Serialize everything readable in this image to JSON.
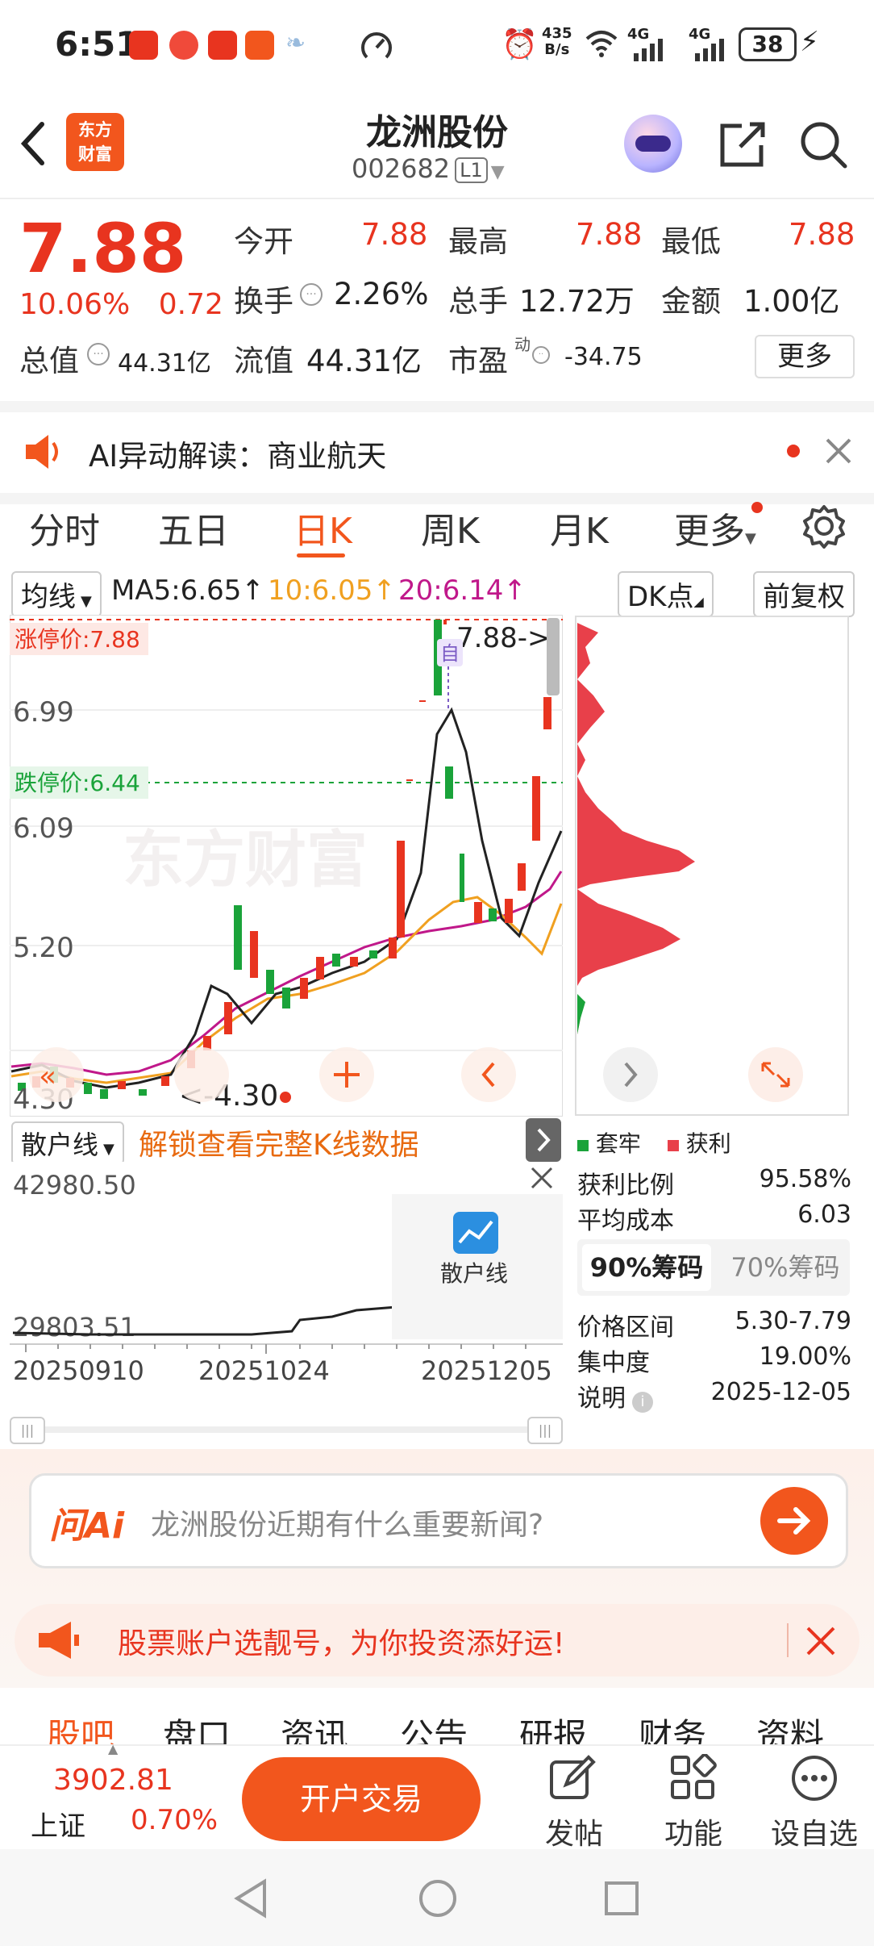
{
  "status_bar": {
    "time": "6:51",
    "net_speed_top": "435",
    "net_speed_unit": "B/s",
    "signal1": "4G",
    "signal2": "4G",
    "battery": "38"
  },
  "header": {
    "logo_line1": "东方",
    "logo_line2": "财富",
    "stock_name": "龙洲股份",
    "stock_code": "002682",
    "level": "L1"
  },
  "quote": {
    "price": "7.88",
    "change_pct": "10.06%",
    "change_abs": "0.72",
    "open_label": "今开",
    "open_value": "7.88",
    "high_label": "最高",
    "high_value": "7.88",
    "low_label": "最低",
    "low_value": "7.88",
    "turnover_label": "换手",
    "turnover_value": "2.26%",
    "volume_label": "总手",
    "volume_value": "12.72万",
    "amount_label": "金额",
    "amount_value": "1.00亿",
    "mktcap_label": "总值",
    "mktcap_value": "44.31亿",
    "float_label": "流值",
    "float_value": "44.31亿",
    "pe_label": "市盈",
    "pe_sup": "动",
    "pe_value": "-34.75",
    "more_label": "更多"
  },
  "ai_row": {
    "text": "AI异动解读：商业航天"
  },
  "tabs": [
    {
      "label": "分时"
    },
    {
      "label": "五日"
    },
    {
      "label": "日K"
    },
    {
      "label": "周K"
    },
    {
      "label": "月K"
    },
    {
      "label": "更多"
    }
  ],
  "indicator_row": {
    "ma_select": "均线",
    "ma5": "MA5:6.65",
    "ma10": "10:6.05",
    "ma20": "20:6.14",
    "dk": "DK点",
    "adjust": "前复权",
    "ma5_color": "#222222",
    "ma10_color": "#f0a020",
    "ma20_color": "#c0188a"
  },
  "kline": {
    "limit_up_label": "涨停价:7.88",
    "limit_down_label": "跌停价:6.44",
    "high_marker": "7.88->",
    "low_marker": "<-4.30",
    "auto_badge": "自",
    "axis_ticks": [
      "6.99",
      "6.09",
      "5.20",
      "4.30"
    ],
    "watermark": "东方财富"
  },
  "chip": {
    "legend_trapped": "套牢",
    "legend_profit": "获利",
    "profit_ratio_label": "获利比例",
    "profit_ratio": "95.58%",
    "avg_cost_label": "平均成本",
    "avg_cost": "6.03",
    "tab90": "90%筹码",
    "tab70": "70%筹码",
    "range_label": "价格区间",
    "range": "5.30-7.79",
    "concentration_label": "集中度",
    "concentration": "19.00%",
    "note_label": "说明",
    "note_date": "2025-12-05"
  },
  "scatter_panel": {
    "select": "散户线",
    "unlock_text": "解锁查看完整K线数据",
    "top_value": "42980.50",
    "bottom_value": "29803.51",
    "lock_label": "散户线",
    "dates": [
      "20250910",
      "20251024",
      "20251205"
    ]
  },
  "ask_ai": {
    "brand": "问Ai",
    "placeholder": "龙洲股份近期有什么重要新闻?"
  },
  "banner": {
    "text": "股票账户选靓号，为你投资添好运!"
  },
  "bottom_tabs": [
    "股吧",
    "盘口",
    "资讯",
    "公告",
    "研报",
    "财务",
    "资料"
  ],
  "footer": {
    "index_value": "3902.81",
    "index_name": "上证",
    "index_change": "0.70%",
    "trade_label": "开户交易",
    "post_label": "发帖",
    "func_label": "功能",
    "watch_label": "设自选"
  }
}
